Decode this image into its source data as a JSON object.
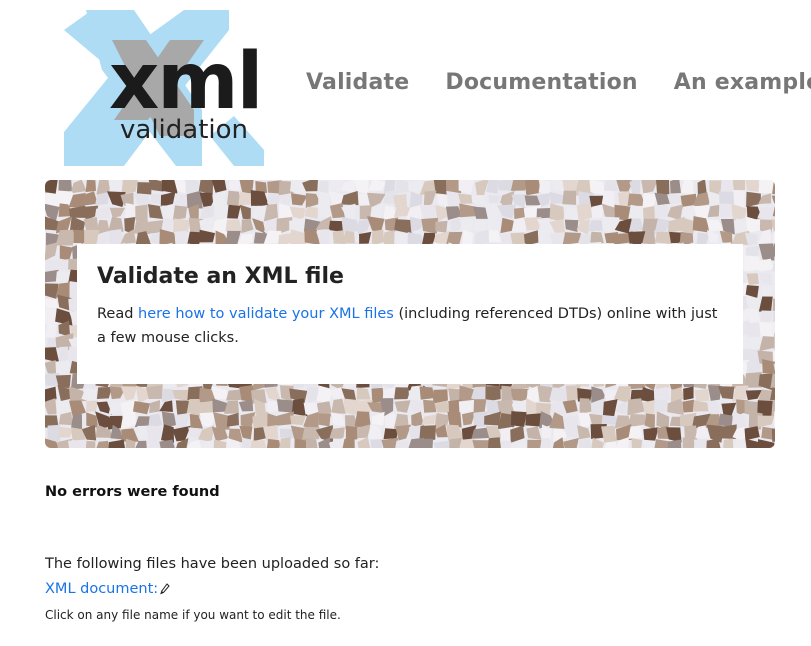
{
  "logo": {
    "text_main": "xml",
    "text_sub": "validation"
  },
  "nav": {
    "items": [
      "Validate",
      "Documentation",
      "An example"
    ]
  },
  "hero": {
    "title": "Validate an XML file",
    "text_before": "Read ",
    "link": "here how to validate your XML files",
    "text_after": " (including referenced DTDs) online with just a few mouse clicks."
  },
  "result": {
    "status": "No errors were found",
    "uploaded_label": "The following files have been uploaded so far:",
    "file_link": "XML document:",
    "hint": "Click on any file name if you want to edit the file."
  },
  "colors": {
    "link": "#1a73e8",
    "nav": "#777777",
    "logo_x": "#a9dcf5"
  }
}
